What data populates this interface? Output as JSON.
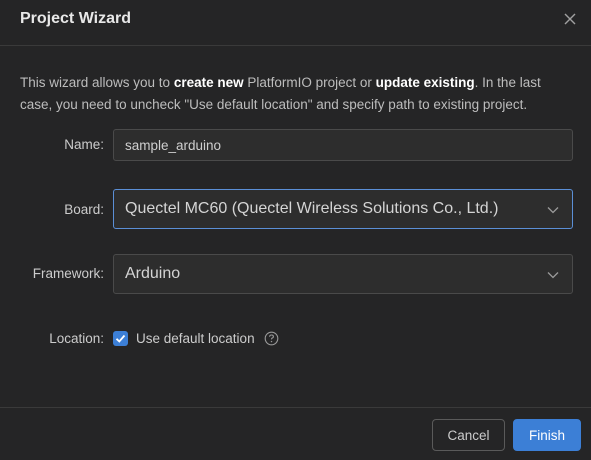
{
  "dialog": {
    "title": "Project Wizard",
    "close_icon": "close-icon"
  },
  "description": {
    "part1": "This wizard allows you to ",
    "bold1": "create new",
    "part2": " PlatformIO project or ",
    "bold2": "update existing",
    "part3": ". In the last case, you need to uncheck \"Use default location\" and specify path to existing project."
  },
  "form": {
    "name": {
      "label": "Name",
      "colon": ":",
      "value": "sample_arduino"
    },
    "board": {
      "label": "Board",
      "colon": ":",
      "value": "Quectel MC60 (Quectel Wireless Solutions Co., Ltd.)",
      "icon": "chevron-down-icon"
    },
    "framework": {
      "label": "Framework",
      "colon": ":",
      "value": "Arduino",
      "icon": "chevron-down-icon"
    },
    "location": {
      "label": "Location",
      "colon": ":",
      "checkbox_checked": true,
      "checkbox_label": "Use default location",
      "help_icon": "question-circle-icon"
    }
  },
  "footer": {
    "cancel_label": "Cancel",
    "finish_label": "Finish"
  },
  "colors": {
    "background": "#252526",
    "accent": "#3c7fd6",
    "focus_border": "#5b8fd6",
    "input_background": "#2d2d2d"
  }
}
